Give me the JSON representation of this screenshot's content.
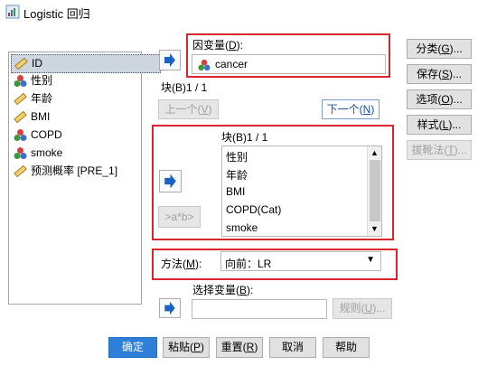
{
  "window": {
    "title": "Logistic 回归"
  },
  "variables": [
    {
      "label": "ID",
      "icon": "ruler-icon",
      "selected": true
    },
    {
      "label": "性别",
      "icon": "nominal-balls-icon"
    },
    {
      "label": "年龄",
      "icon": "ruler-icon"
    },
    {
      "label": "BMI",
      "icon": "ruler-icon"
    },
    {
      "label": "COPD",
      "icon": "nominal-balls-icon"
    },
    {
      "label": "smoke",
      "icon": "nominal-balls-icon"
    },
    {
      "label": "预测概率 [PRE_1]",
      "icon": "ruler-icon"
    }
  ],
  "dependent": {
    "label": "因变量(",
    "mnemonic": "D",
    "label_end": "):",
    "value": "cancer"
  },
  "block": {
    "header": "块(B)1 / 1",
    "prev_label": "上一个(",
    "prev_mn": "V",
    "next_label": "下一个(",
    "next_mn": "N",
    "inner_header": "块(B)1 / 1",
    "covariates": [
      "性别",
      "年龄",
      "BMI",
      "COPD(Cat)",
      "smoke"
    ],
    "interaction_label": ">a*b>"
  },
  "method": {
    "label": "方法(",
    "mnemonic": "M",
    "label_end": "):",
    "value": "向前：LR"
  },
  "selection": {
    "label": "选择变量(",
    "mnemonic": "B",
    "label_end": "):",
    "value": "",
    "rule_label": "规则(",
    "rule_mn": "U",
    "rule_end": ")..."
  },
  "side_buttons": [
    {
      "label": "分类(",
      "mn": "G",
      "end": ")...",
      "enabled": true
    },
    {
      "label": "保存(",
      "mn": "S",
      "end": ")...",
      "enabled": true
    },
    {
      "label": "选项(",
      "mn": "O",
      "end": ")...",
      "enabled": true
    },
    {
      "label": "样式(",
      "mn": "L",
      "end": ")...",
      "enabled": true
    },
    {
      "label": "拔靴法(",
      "mn": "T",
      "end": ")...",
      "enabled": false
    }
  ],
  "bottom_buttons": [
    {
      "label": "确定",
      "mn": "",
      "end": ""
    },
    {
      "label": "粘贴(",
      "mn": "P",
      "end": ")"
    },
    {
      "label": "重置(",
      "mn": "R",
      "end": ")"
    },
    {
      "label": "取消",
      "mn": "",
      "end": ""
    },
    {
      "label": "帮助",
      "mn": "",
      "end": ""
    }
  ],
  "colors": {
    "highlight": "#d8262c",
    "primary": "#2d7fd8",
    "arrow": "#1c62c4"
  }
}
